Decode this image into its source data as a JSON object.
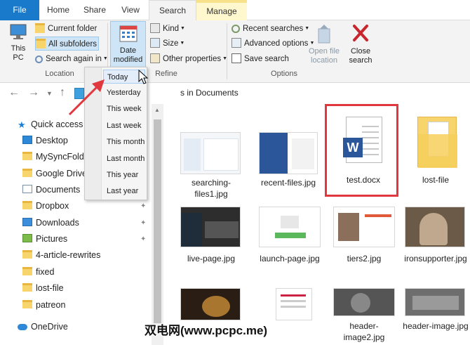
{
  "tabs": {
    "file": "File",
    "home": "Home",
    "share": "Share",
    "view": "View",
    "search": "Search",
    "manage": "Manage"
  },
  "ribbon": {
    "location": {
      "this_pc": "This PC",
      "current_folder": "Current folder",
      "all_subfolders": "All subfolders",
      "search_again_in": "Search again in",
      "group_label": "Location"
    },
    "refine": {
      "date_modified": "Date modified",
      "kind": "Kind",
      "size": "Size",
      "other_properties": "Other properties",
      "group_label": "Refine"
    },
    "options": {
      "recent_searches": "Recent searches",
      "advanced_options": "Advanced options",
      "save_search": "Save search",
      "open_file_location": "Open file location",
      "close_search": "Close search",
      "group_label": "Options"
    }
  },
  "breadcrumb": "s in Documents",
  "date_menu": {
    "items": [
      "Today",
      "Yesterday",
      "This week",
      "Last week",
      "This month",
      "Last month",
      "This year",
      "Last year"
    ]
  },
  "tree": {
    "items": [
      {
        "label": "Quick access",
        "icon": "star-icon"
      },
      {
        "label": "Desktop",
        "icon": "desktop-icon"
      },
      {
        "label": "MySyncFolde",
        "icon": "folder-icon"
      },
      {
        "label": "Google Drive",
        "icon": "folder-icon"
      },
      {
        "label": "Documents",
        "icon": "documents-icon"
      },
      {
        "label": "Dropbox",
        "icon": "folder-icon"
      },
      {
        "label": "Downloads",
        "icon": "downloads-icon"
      },
      {
        "label": "Pictures",
        "icon": "pictures-icon"
      },
      {
        "label": "4-article-rewrites",
        "icon": "folder-icon"
      },
      {
        "label": "fixed",
        "icon": "folder-icon"
      },
      {
        "label": "lost-file",
        "icon": "folder-icon"
      },
      {
        "label": "patreon",
        "icon": "folder-icon"
      },
      {
        "label": "OneDrive",
        "icon": "cloud-icon"
      }
    ]
  },
  "files": {
    "row1": [
      "searching-files1.jpg",
      "recent-files.jpg",
      "test.docx",
      "lost-file"
    ],
    "row2": [
      "live-page.jpg",
      "launch-page.jpg",
      "tiers2.jpg",
      "ironsupporter.jpg"
    ],
    "row3": [
      "header-image2.jpg",
      "header-image.jpg"
    ]
  },
  "word_letter": "W",
  "watermark": "双电网(www.pcpc.me)",
  "colors": {
    "accent": "#1979ca",
    "highlight": "#e0383e",
    "word_blue": "#2b579a"
  }
}
